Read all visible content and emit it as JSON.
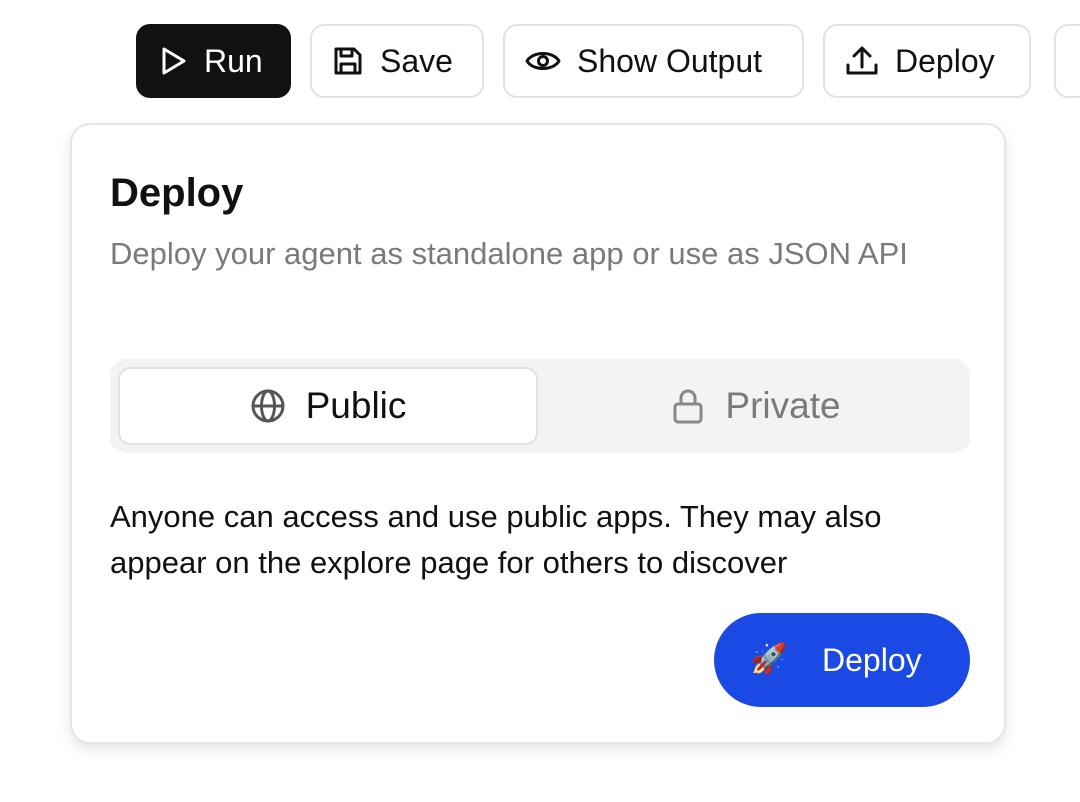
{
  "toolbar": {
    "run_label": "Run",
    "save_label": "Save",
    "show_output_label": "Show Output",
    "deploy_label": "Deploy"
  },
  "icons": {
    "run": "play-icon",
    "save": "floppy-disk-icon",
    "show_output": "eye-icon",
    "deploy": "upload-icon",
    "public": "globe-icon",
    "private": "lock-icon",
    "primary": "rocket-icon"
  },
  "deploy_panel": {
    "title": "Deploy",
    "description": "Deploy your agent as standalone app or use as JSON API",
    "visibility": {
      "selected": "Public",
      "options": [
        "Public",
        "Private"
      ]
    },
    "info_text": "Anyone can access and use public apps. They may also appear on the explore page for others to discover",
    "deploy_button_icon": "🚀",
    "deploy_button_label": "Deploy"
  },
  "colors": {
    "run_button_bg": "#111111",
    "primary_button_bg": "#1b49e4",
    "muted_text": "#7a7a7a",
    "segment_bg": "#f3f3f3"
  }
}
